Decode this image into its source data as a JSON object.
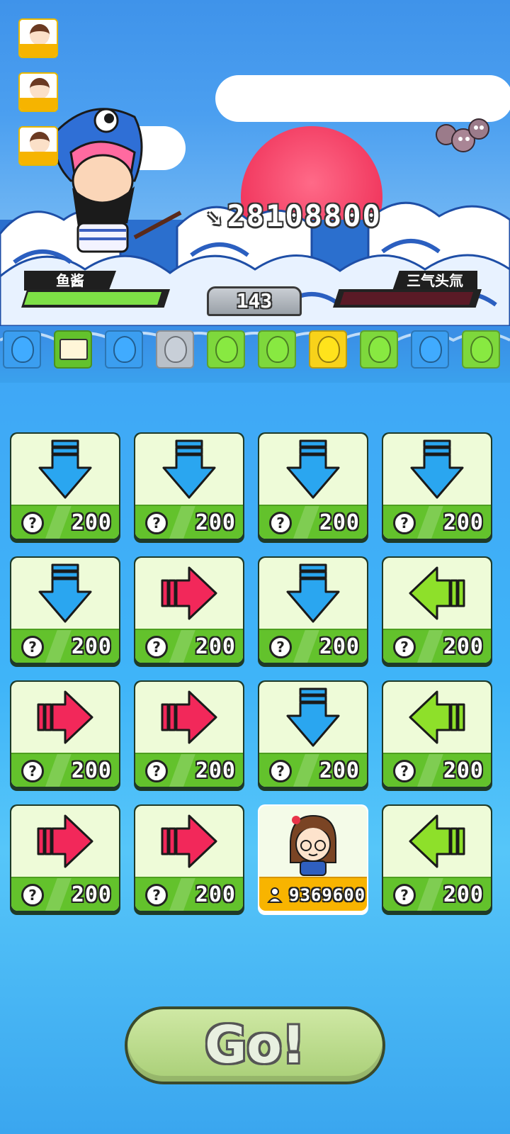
{
  "battle": {
    "score": "28108800",
    "round": "143",
    "player": {
      "name": "鱼酱",
      "hp_fraction": 0.97
    },
    "opponent": {
      "name": "三气头氚",
      "hp_fraction": 0.0
    }
  },
  "slots": [
    {
      "type": "balloon",
      "color": "#3b9ef0"
    },
    {
      "type": "card",
      "color": "#63c22c"
    },
    {
      "type": "balloon",
      "color": "#3b9ef0"
    },
    {
      "type": "balloon",
      "color": "#b9c0c8"
    },
    {
      "type": "balloon",
      "color": "#7ed83c"
    },
    {
      "type": "balloon",
      "color": "#7ed83c"
    },
    {
      "type": "balloon",
      "color": "#f8d21a"
    },
    {
      "type": "balloon",
      "color": "#7ed83c"
    },
    {
      "type": "balloon",
      "color": "#3b9ef0"
    },
    {
      "type": "balloon",
      "color": "#7ed83c"
    }
  ],
  "tiles": [
    {
      "dir": "down",
      "cost": "200"
    },
    {
      "dir": "down",
      "cost": "200"
    },
    {
      "dir": "down",
      "cost": "200"
    },
    {
      "dir": "down",
      "cost": "200"
    },
    {
      "dir": "down",
      "cost": "200"
    },
    {
      "dir": "right",
      "cost": "200"
    },
    {
      "dir": "down",
      "cost": "200"
    },
    {
      "dir": "left",
      "cost": "200"
    },
    {
      "dir": "right",
      "cost": "200"
    },
    {
      "dir": "right",
      "cost": "200"
    },
    {
      "dir": "down",
      "cost": "200"
    },
    {
      "dir": "left",
      "cost": "200"
    },
    {
      "dir": "right",
      "cost": "200"
    },
    {
      "dir": "right",
      "cost": "200"
    },
    {
      "dir": "special",
      "cost": "9369600"
    },
    {
      "dir": "left",
      "cost": "200"
    }
  ],
  "tile_icons": {
    "question": "?",
    "cost_icon": "person-icon"
  },
  "colors": {
    "down": "#2aa6f0",
    "right": "#f2285a",
    "left": "#8ee02a"
  },
  "go_button": {
    "label": "Go!"
  }
}
